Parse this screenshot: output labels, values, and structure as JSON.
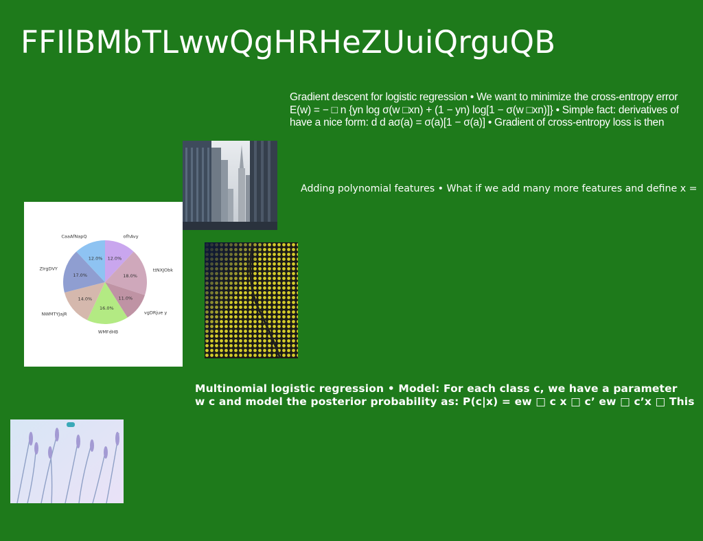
{
  "title": "FFIlBMbTLwwQgHRHeZUuiQrguQB",
  "block1": {
    "line1": "Gradient descent for logistic regression • We want to minimize the cross-entropy error",
    "line2": "E(w) = − □ n {yn log σ(w □xn) + (1 − yn) log[1 − σ(w □xn)]} • Simple fact: derivatives of",
    "line3": "have a nice form: d d aσ(a) = σ(a)[1 − σ(a)] • Gradient of cross-entropy loss is then"
  },
  "block2": {
    "line1": "Adding polynomial features • What if we add many more features and define x ="
  },
  "block3": {
    "line1": "Multinomial logistic regression • Model: For each class c, we have a parameter",
    "line2": "w c and model the posterior probability as: P(c|x) = ew □ c x □ c’ ew □ c’x □ This"
  },
  "chart_data": {
    "type": "pie",
    "title": "",
    "start_angle_deg": 90,
    "direction": "clockwise",
    "slices": [
      {
        "label": "ofhAvy",
        "value": 12.0,
        "pct_label": "12.0%",
        "color": "#c9a6ee"
      },
      {
        "label": "ttNXJObk",
        "value": 18.0,
        "pct_label": "18.0%",
        "color": "#cfa8bb"
      },
      {
        "label": "vgDRjue y",
        "value": 11.0,
        "pct_label": "11.0%",
        "color": "#bf93a4"
      },
      {
        "label": "WMFdHB",
        "value": 16.0,
        "pct_label": "16.0%",
        "color": "#b3ea83"
      },
      {
        "label": "NWMTYJajR",
        "value": 14.0,
        "pct_label": "14.0%",
        "color": "#d5b8ad"
      },
      {
        "label": "ZIrgDVY",
        "value": 17.0,
        "pct_label": "17.0%",
        "color": "#8f9ed1"
      },
      {
        "label": "CaaAfNapQ",
        "value": 12.0,
        "pct_label": "12.0%",
        "color": "#8ec3f2"
      }
    ]
  },
  "images": {
    "city": "city-street-skyscrapers-photo",
    "mosaic": "yellow-tile-mosaic-photo",
    "lavender": "lavender-field-photo"
  }
}
